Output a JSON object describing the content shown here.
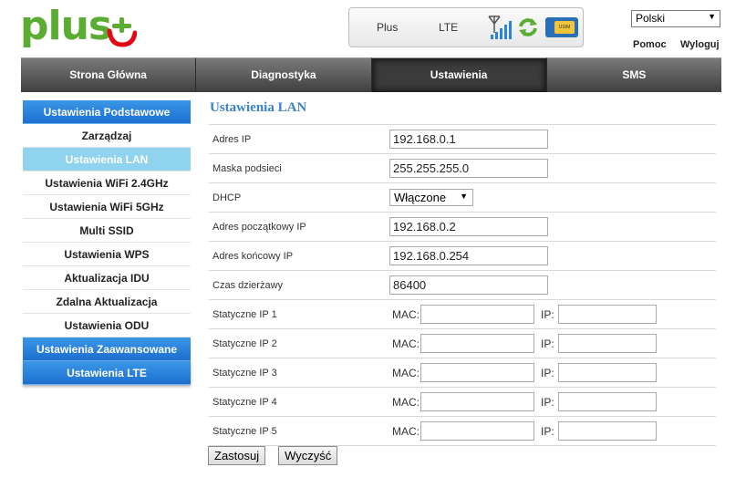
{
  "brand": {
    "logo_text": "plus"
  },
  "status": {
    "operator": "Plus",
    "network": "LTE",
    "sim_label": "USIM"
  },
  "top": {
    "language": "Polski",
    "help": "Pomoc",
    "logout": "Wyloguj"
  },
  "nav": {
    "home": "Strona Główna",
    "diagnostics": "Diagnostyka",
    "settings": "Ustawienia",
    "sms": "SMS"
  },
  "sidebar": {
    "basic": "Ustawienia Podstawowe",
    "items": [
      "Zarządzaj",
      "Ustawienia LAN",
      "Ustawienia WiFi 2.4GHz",
      "Ustawienia WiFi 5GHz",
      "Multi SSID",
      "Ustawienia WPS",
      "Aktualizacja IDU",
      "Zdalna Aktualizacja",
      "Ustawienia ODU"
    ],
    "advanced": "Ustawienia Zaawansowane",
    "lte": "Ustawienia LTE"
  },
  "form": {
    "title": "Ustawienia LAN",
    "ip_label": "Adres IP",
    "ip_value": "192.168.0.1",
    "mask_label": "Maska podsieci",
    "mask_value": "255.255.255.0",
    "dhcp_label": "DHCP",
    "dhcp_value": "Włączone",
    "start_label": "Adres początkowy IP",
    "start_value": "192.168.0.2",
    "end_label": "Adres końcowy IP",
    "end_value": "192.168.0.254",
    "lease_label": "Czas dzierżawy",
    "lease_value": "86400",
    "mac_label": "MAC:",
    "ipcol_label": "IP:",
    "static": [
      "Statyczne IP 1",
      "Statyczne IP 2",
      "Statyczne IP 3",
      "Statyczne IP 4",
      "Statyczne IP 5"
    ]
  },
  "buttons": {
    "apply": "Zastosuj",
    "clear": "Wyczyść"
  },
  "colors": {
    "brand_green": "#5aad32",
    "brand_red": "#e30613",
    "accent_blue": "#3b82c9",
    "sidebar_blue": "#2a84de",
    "sidebar_active": "#8fd3ee"
  }
}
